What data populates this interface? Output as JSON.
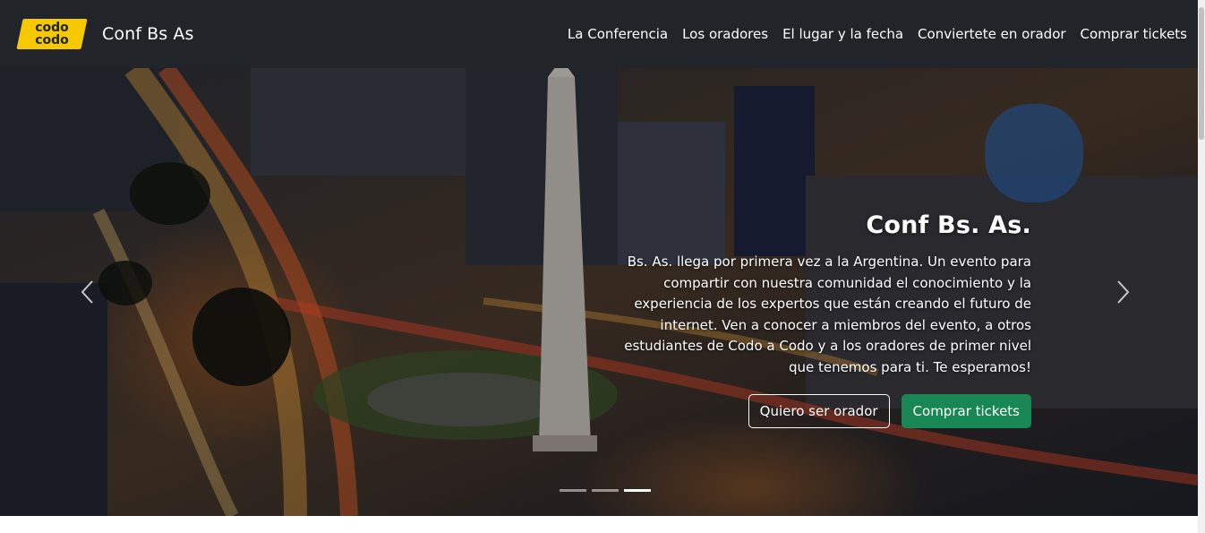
{
  "navbar": {
    "logo_text_line1": "codo",
    "logo_text_line2": "codo",
    "brand": "Conf Bs As",
    "links": [
      "La Conferencia",
      "Los oradores",
      "El lugar y la fecha",
      "Conviertete en orador",
      "Comprar tickets"
    ]
  },
  "hero": {
    "title": "Conf Bs. As.",
    "description": "Bs. As. llega por primera vez a la Argentina. Un evento para compartir con nuestra comunidad el conocimiento y la experiencia de los expertos que están creando el futuro de internet. Ven a conocer a miembros del evento, a otros estudiantes de Codo a Codo y a los oradores de primer nivel que tenemos para ti. Te esperamos!",
    "btn_speaker": "Quiero ser orador",
    "btn_tickets": "Comprar tickets",
    "slides": 3,
    "active_slide": 3
  },
  "colors": {
    "navbar_bg": "#212529",
    "logo_yellow": "#f6c800",
    "success": "#198754"
  }
}
